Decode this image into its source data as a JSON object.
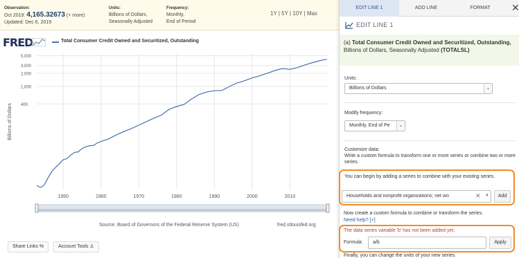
{
  "observation": {
    "label": "Observation:",
    "date": "Oct 2019:",
    "value": "4,165.32673",
    "more": "(+ more)",
    "updated": "Updated: Dec 6, 2019"
  },
  "units_meta": {
    "label": "Units:",
    "line1": "Billions of Dollars,",
    "line2": "Seasonally Adjusted"
  },
  "frequency_meta": {
    "label": "Frequency:",
    "line1": "Monthly,",
    "line2": "End of Period"
  },
  "ranges": "1Y | 5Y | 10Y | Max",
  "logo": "FRED",
  "chart_title": "Total Consumer Credit Owned and Securitized, Outstanding",
  "source": "Source: Board of Governors of the Federal Reserve System (US)",
  "source_url": "fred.stlouisfed.org",
  "buttons": {
    "share": "Share Links %",
    "account": "Account Tools ♙"
  },
  "colors": {
    "line": "#4572a7",
    "highlight": "#f08a2a",
    "error": "#c0392b"
  },
  "chart_data": {
    "type": "line",
    "title": "Total Consumer Credit Owned and Securitized, Outstanding",
    "ylabel": "Billions of Dollars",
    "y_scale": "log",
    "y_ticks": [
      400,
      1000,
      2000,
      3000,
      5000
    ],
    "y_tick_labels": [
      "400",
      "1,000",
      "2,000",
      "3,000",
      "5,000"
    ],
    "x_ticks": [
      1950,
      1960,
      1970,
      1980,
      1990,
      2000,
      2010
    ],
    "xlim": [
      1943,
      2020
    ],
    "ylim": [
      4.5,
      5500
    ],
    "grid": true,
    "series": [
      {
        "name": "Total Consumer Credit Owned and Securitized, Outstanding",
        "x": [
          1943,
          1944,
          1945,
          1946,
          1947,
          1948,
          1949,
          1950,
          1951,
          1952,
          1953,
          1954,
          1955,
          1956,
          1957,
          1958,
          1959,
          1960,
          1962,
          1964,
          1966,
          1968,
          1970,
          1972,
          1974,
          1976,
          1978,
          1980,
          1982,
          1984,
          1986,
          1988,
          1990,
          1992,
          1994,
          1996,
          1998,
          2000,
          2002,
          2004,
          2006,
          2008,
          2009,
          2010,
          2012,
          2014,
          2016,
          2018,
          2019.8
        ],
        "y": [
          5.6,
          5.0,
          5.7,
          8.4,
          11.6,
          14.4,
          17.4,
          21.5,
          22.7,
          27.5,
          31.4,
          32.5,
          38.8,
          42.1,
          44.8,
          45.1,
          51.5,
          56.0,
          63.8,
          78.4,
          93.8,
          110,
          131,
          158,
          190,
          223,
          300,
          350,
          390,
          520,
          660,
          750,
          800,
          810,
          1000,
          1200,
          1350,
          1560,
          1750,
          2000,
          2300,
          2560,
          2500,
          2450,
          2700,
          3100,
          3500,
          3900,
          4165.33
        ]
      }
    ]
  },
  "panel": {
    "tabs": [
      "EDIT LINE 1",
      "ADD LINE",
      "FORMAT"
    ],
    "close": "✕",
    "heading": "EDIT LINE 1",
    "series_label": "(a)",
    "series_title": "Total Consumer Credit Owned and Securitized, Outstanding,",
    "series_units": "Billions of Dollars, Seasonally Adjusted",
    "series_code": "(TOTALSL)",
    "units_label": "Units:",
    "units_value": "Billions of Dollars",
    "freq_label": "Modify frequency:",
    "freq_value": "Monthly, End of Pe",
    "customize_label": "Customize data:",
    "customize_desc": "Write a custom formula to transform one or more series or combine two or more series.",
    "combine_hint": "You can begin by adding a series to combine with your existing series.",
    "combine_value": "Households and nonprofit organizations; net wo",
    "add_button": "Add",
    "formula_hint": "Now create a custom formula to combine or transform the series.",
    "need_help": "Need help? [+]",
    "error": "The data series variable 'b' has not been added yet.",
    "formula_label": "Formula:",
    "formula_value": "a/b",
    "apply_button": "Apply",
    "finally": "Finally, you can change the units of your new series."
  }
}
